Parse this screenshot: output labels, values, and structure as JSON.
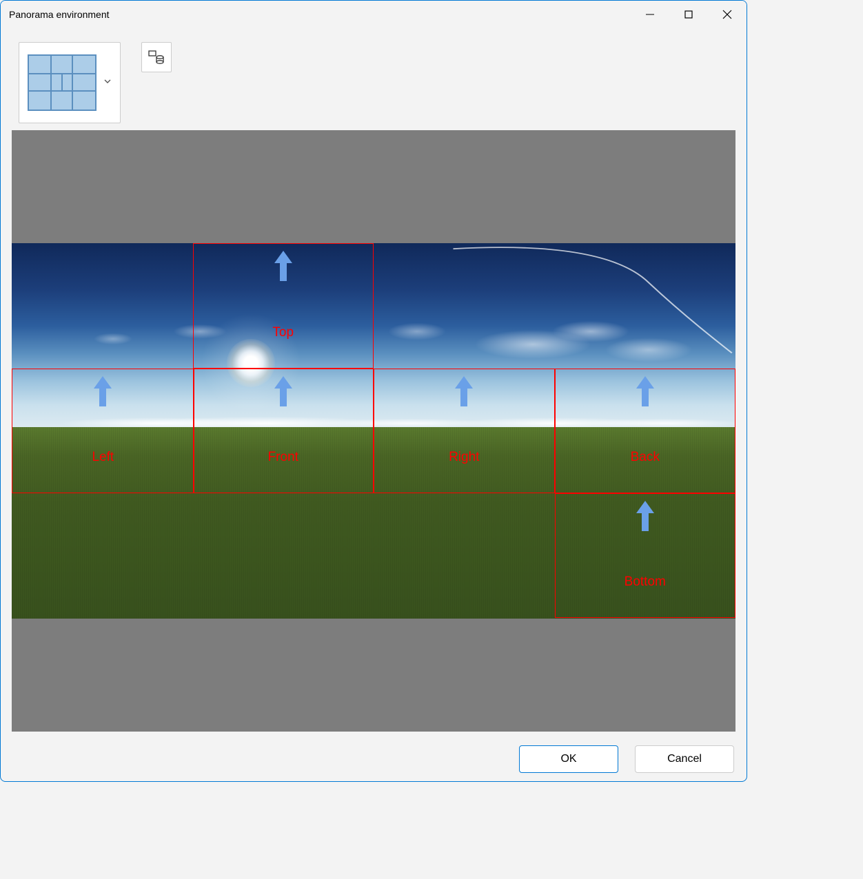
{
  "window": {
    "title": "Panorama environment"
  },
  "toolbar": {
    "layout_selector_tooltip": "Cube map layout",
    "primitives_tooltip": "Primitives"
  },
  "tiles": {
    "top": {
      "label": "Top"
    },
    "left": {
      "label": "Left"
    },
    "front": {
      "label": "Front"
    },
    "right": {
      "label": "Right"
    },
    "back": {
      "label": "Back"
    },
    "bottom": {
      "label": "Bottom"
    }
  },
  "buttons": {
    "ok": "OK",
    "cancel": "Cancel"
  },
  "colors": {
    "overlay_stroke": "#ff0000",
    "arrow_fill": "#6aa0e8",
    "window_accent": "#0078d4"
  }
}
